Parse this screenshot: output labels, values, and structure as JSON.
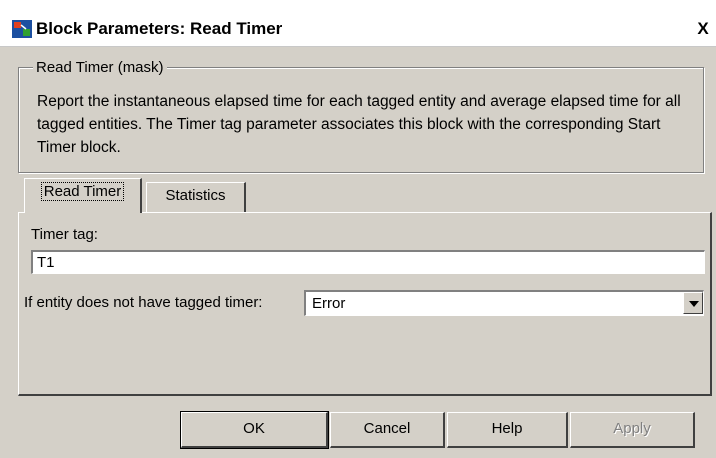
{
  "window": {
    "title": "Block Parameters: Read Timer",
    "close_glyph": "X"
  },
  "group": {
    "legend": "Read Timer (mask)",
    "description": "Report the instantaneous elapsed time for each tagged entity and average elapsed time for all tagged entities. The Timer tag parameter associates this block with the corresponding Start Timer block."
  },
  "tabs": [
    {
      "label": "Read Timer",
      "active": true
    },
    {
      "label": "Statistics",
      "active": false
    }
  ],
  "fields": {
    "timer_tag_label": "Timer tag:",
    "timer_tag_value": "T1",
    "entity_label": "If entity does not have tagged timer:",
    "entity_value": "Error"
  },
  "buttons": {
    "ok": "OK",
    "cancel": "Cancel",
    "help": "Help",
    "apply": "Apply"
  },
  "icons": {
    "app": "simulink-block-icon",
    "close": "close-icon",
    "dropdown": "chevron-down-icon"
  },
  "colors": {
    "dialog_bg": "#d4d0c8",
    "titlebar_bg": "#ffffff",
    "disabled_text": "#808080"
  }
}
